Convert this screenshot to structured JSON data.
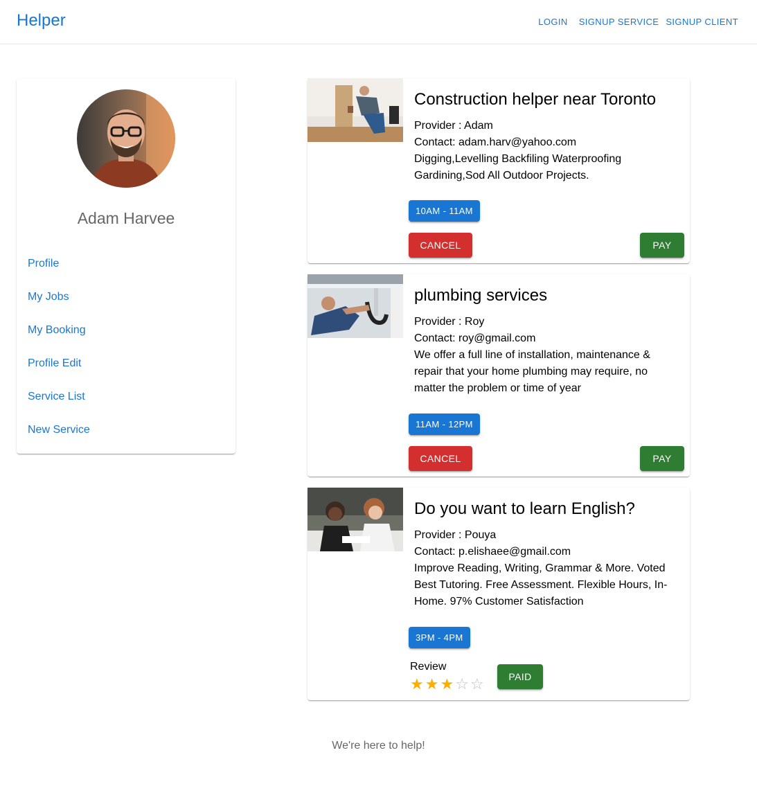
{
  "app": {
    "brand": "Helper"
  },
  "nav": {
    "login": "LOGIN",
    "signup_service": "SIGNUP SERVICE",
    "signup_client": "SIGNUP CLIENT"
  },
  "sidebar": {
    "user_name": "Adam Harvee",
    "items": [
      {
        "label": "Profile"
      },
      {
        "label": "My Jobs"
      },
      {
        "label": "My Booking"
      },
      {
        "label": "Profile Edit"
      },
      {
        "label": "Service List"
      },
      {
        "label": "New Service"
      }
    ]
  },
  "bookings": [
    {
      "title": "Construction helper near Toronto",
      "provider": "Provider : Adam",
      "contact": "Contact: adam.harv@yahoo.com",
      "description": "Digging,Levelling Backfiling Waterproofing Gardining,Sod All Outdoor Projects.",
      "time": "10AM - 11AM",
      "cancel_label": "CANCEL",
      "pay_label": "PAY"
    },
    {
      "title": "plumbing services",
      "provider": "Provider : Roy",
      "contact": "Contact: roy@gmail.com",
      "description": "We offer a full line of installation, maintenance & repair that your home plumbing may require, no matter the problem or time of year",
      "time": "11AM - 12PM",
      "cancel_label": "CANCEL",
      "pay_label": "PAY"
    },
    {
      "title": "Do you want to learn English?",
      "provider": "Provider : Pouya",
      "contact": "Contact: p.elishaee@gmail.com",
      "description": "Improve Reading, Writing, Grammar & More. Voted Best Tutoring. Free Assessment. Flexible Hours, In-Home. 97% Customer Satisfaction",
      "time": "3PM - 4PM",
      "review_label": "Review",
      "rating": 3,
      "rating_max": 5,
      "paid_label": "PAID"
    }
  ],
  "footer": {
    "text": "We're here to help!"
  },
  "colors": {
    "primary": "#1976d2",
    "cancel": "#d32f2f",
    "success": "#2e7d32",
    "star": "#faaf00"
  }
}
